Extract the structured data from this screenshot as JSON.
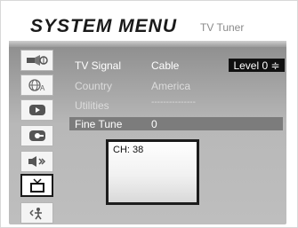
{
  "header": {
    "title": "SYSTEM MENU",
    "subtitle": "TV Tuner"
  },
  "level_selector": {
    "label": "Level 0 ≑"
  },
  "rows": [
    {
      "label": "TV Signal",
      "value": "Cable"
    },
    {
      "label": "Country",
      "value": "America"
    },
    {
      "label": "Utilities",
      "value": "---------------"
    },
    {
      "label": "Fine Tune",
      "value": "0"
    }
  ],
  "sidebar": {
    "items": [
      {
        "name": "picture-icon"
      },
      {
        "name": "language-icon"
      },
      {
        "name": "channel-icon"
      },
      {
        "name": "parental-icon"
      },
      {
        "name": "audio-icon"
      },
      {
        "name": "tv-tuner-icon",
        "active": true
      },
      {
        "name": "setup-icon"
      }
    ]
  },
  "preview": {
    "channel_text": "CH: 38"
  },
  "colors": {
    "panel_gray": "#b8b8b8",
    "highlight": "#7c7c7c",
    "level_bg": "#111111"
  }
}
